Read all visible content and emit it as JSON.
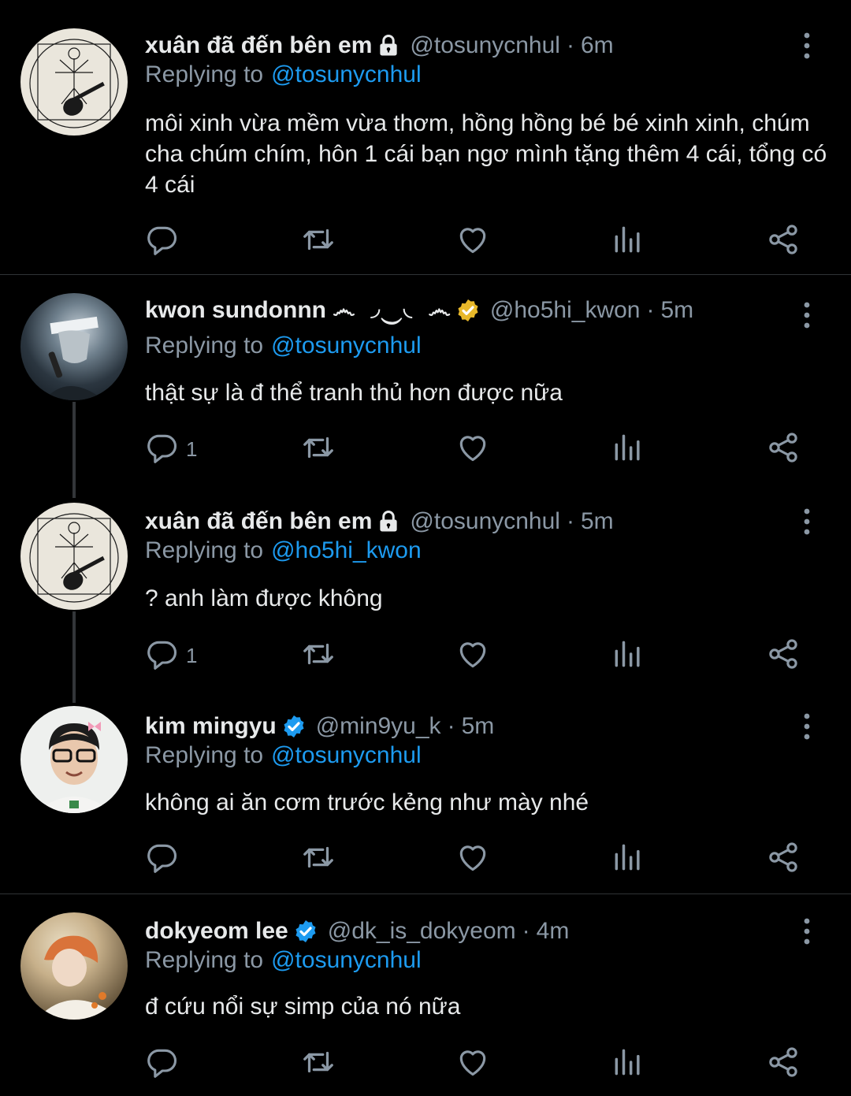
{
  "tweets": [
    {
      "name": "xuân đã đến bên em",
      "handle": "@tosunycnhul",
      "time": "6m",
      "replying_label": "Replying to",
      "replying_to": "@tosunycnhul",
      "text": "môi xinh vừa mềm vừa thơm, hồng hồng bé bé xinh xinh, chúm cha chúm chím, hôn 1 cái bạn ngơ mình tặng thêm 4 cái, tổng có 4 cái",
      "reply_count": "",
      "badge": "lock-icon"
    },
    {
      "name": "kwon sundonnn ෴ ◞‿◟ ෴",
      "handle": "@ho5hi_kwon",
      "time": "5m",
      "replying_label": "Replying to",
      "replying_to": "@tosunycnhul",
      "text": "thật sự là đ thể tranh thủ hơn được nữa",
      "reply_count": "1",
      "badge": "verified-gold-icon"
    },
    {
      "name": "xuân đã đến bên em",
      "handle": "@tosunycnhul",
      "time": "5m",
      "replying_label": "Replying to",
      "replying_to": "@ho5hi_kwon",
      "text": "? anh làm được không",
      "reply_count": "1",
      "badge": "lock-icon"
    },
    {
      "name": "kim mingyu",
      "handle": "@min9yu_k",
      "time": "5m",
      "replying_label": "Replying to",
      "replying_to": "@tosunycnhul",
      "text": "không ai ăn cơm trước kẻng như mày nhé",
      "reply_count": "",
      "badge": "verified-blue-icon"
    },
    {
      "name": "dokyeom lee",
      "handle": "@dk_is_dokyeom",
      "time": "4m",
      "replying_label": "Replying to",
      "replying_to": "@tosunycnhul",
      "text": "đ cứu nổi sự simp của nó nữa",
      "reply_count": "",
      "badge": "verified-blue-icon"
    }
  ],
  "colors": {
    "background": "#000000",
    "text": "#e7e9ea",
    "muted": "#8b98a5",
    "accent": "#1d9bf0",
    "verified_gold": "#e8b82a",
    "divider": "#2f3336"
  }
}
